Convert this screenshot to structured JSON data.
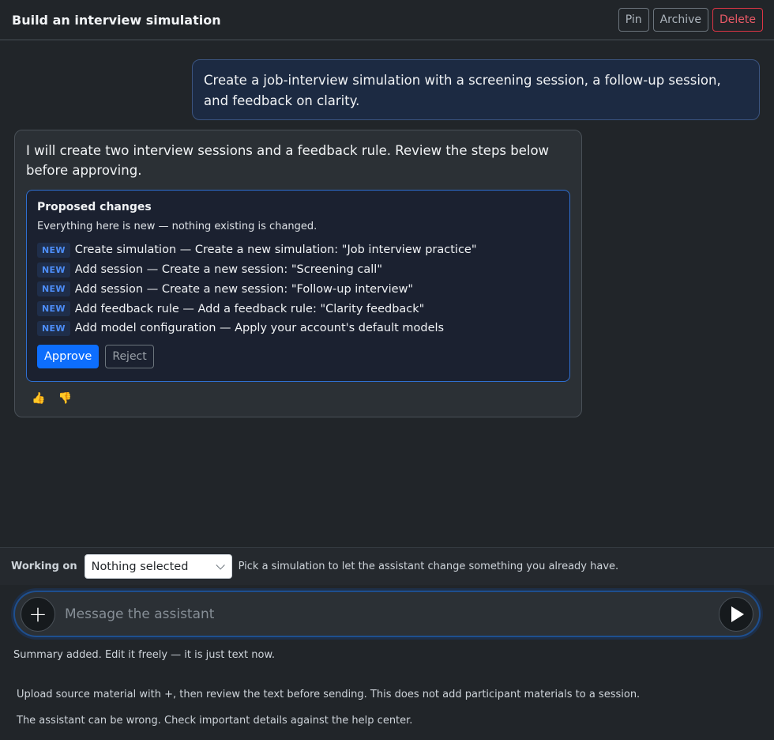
{
  "header": {
    "title": "Build an interview simulation",
    "pin_label": "Pin",
    "archive_label": "Archive",
    "delete_label": "Delete"
  },
  "user_message": "Create a job-interview simulation with a screening session, a follow-up session, and feedback on clarity.",
  "assistant_message": {
    "text": "I will create two interview sessions and a feedback rule. Review the steps below before approving.",
    "proposal": {
      "title": "Proposed changes",
      "note": "Everything here is new — nothing existing is changed.",
      "changes": [
        {
          "badge": "NEW",
          "text": "Create simulation — Create a new simulation: \"Job interview practice\""
        },
        {
          "badge": "NEW",
          "text": "Add session — Create a new session: \"Screening call\""
        },
        {
          "badge": "NEW",
          "text": "Add session — Create a new session: \"Follow-up interview\""
        },
        {
          "badge": "NEW",
          "text": "Add feedback rule — Add a feedback rule: \"Clarity feedback\""
        },
        {
          "badge": "NEW",
          "text": "Add model configuration — Apply your account's default models"
        }
      ],
      "approve_label": "Approve",
      "reject_label": "Reject"
    },
    "thumbs_up_icon": "thumbs-up-icon",
    "thumbs_down_icon": "thumbs-down-icon"
  },
  "working_on": {
    "label": "Working on",
    "selected": "Nothing selected",
    "hint": "Pick a simulation to let the assistant change something you already have."
  },
  "composer": {
    "placeholder": "Message the assistant"
  },
  "footer": {
    "summary_status": "Summary added. Edit it freely — it is just text now.",
    "upload_hint": "Upload source material with +, then review the text before sending. This does not add participant materials to a session.",
    "disclaimer": "The assistant can be wrong. Check important details against the help center."
  },
  "colors": {
    "background": "#212529",
    "accent": "#0d6efd",
    "danger": "#dc3545",
    "badge_text": "#4d8df7"
  }
}
